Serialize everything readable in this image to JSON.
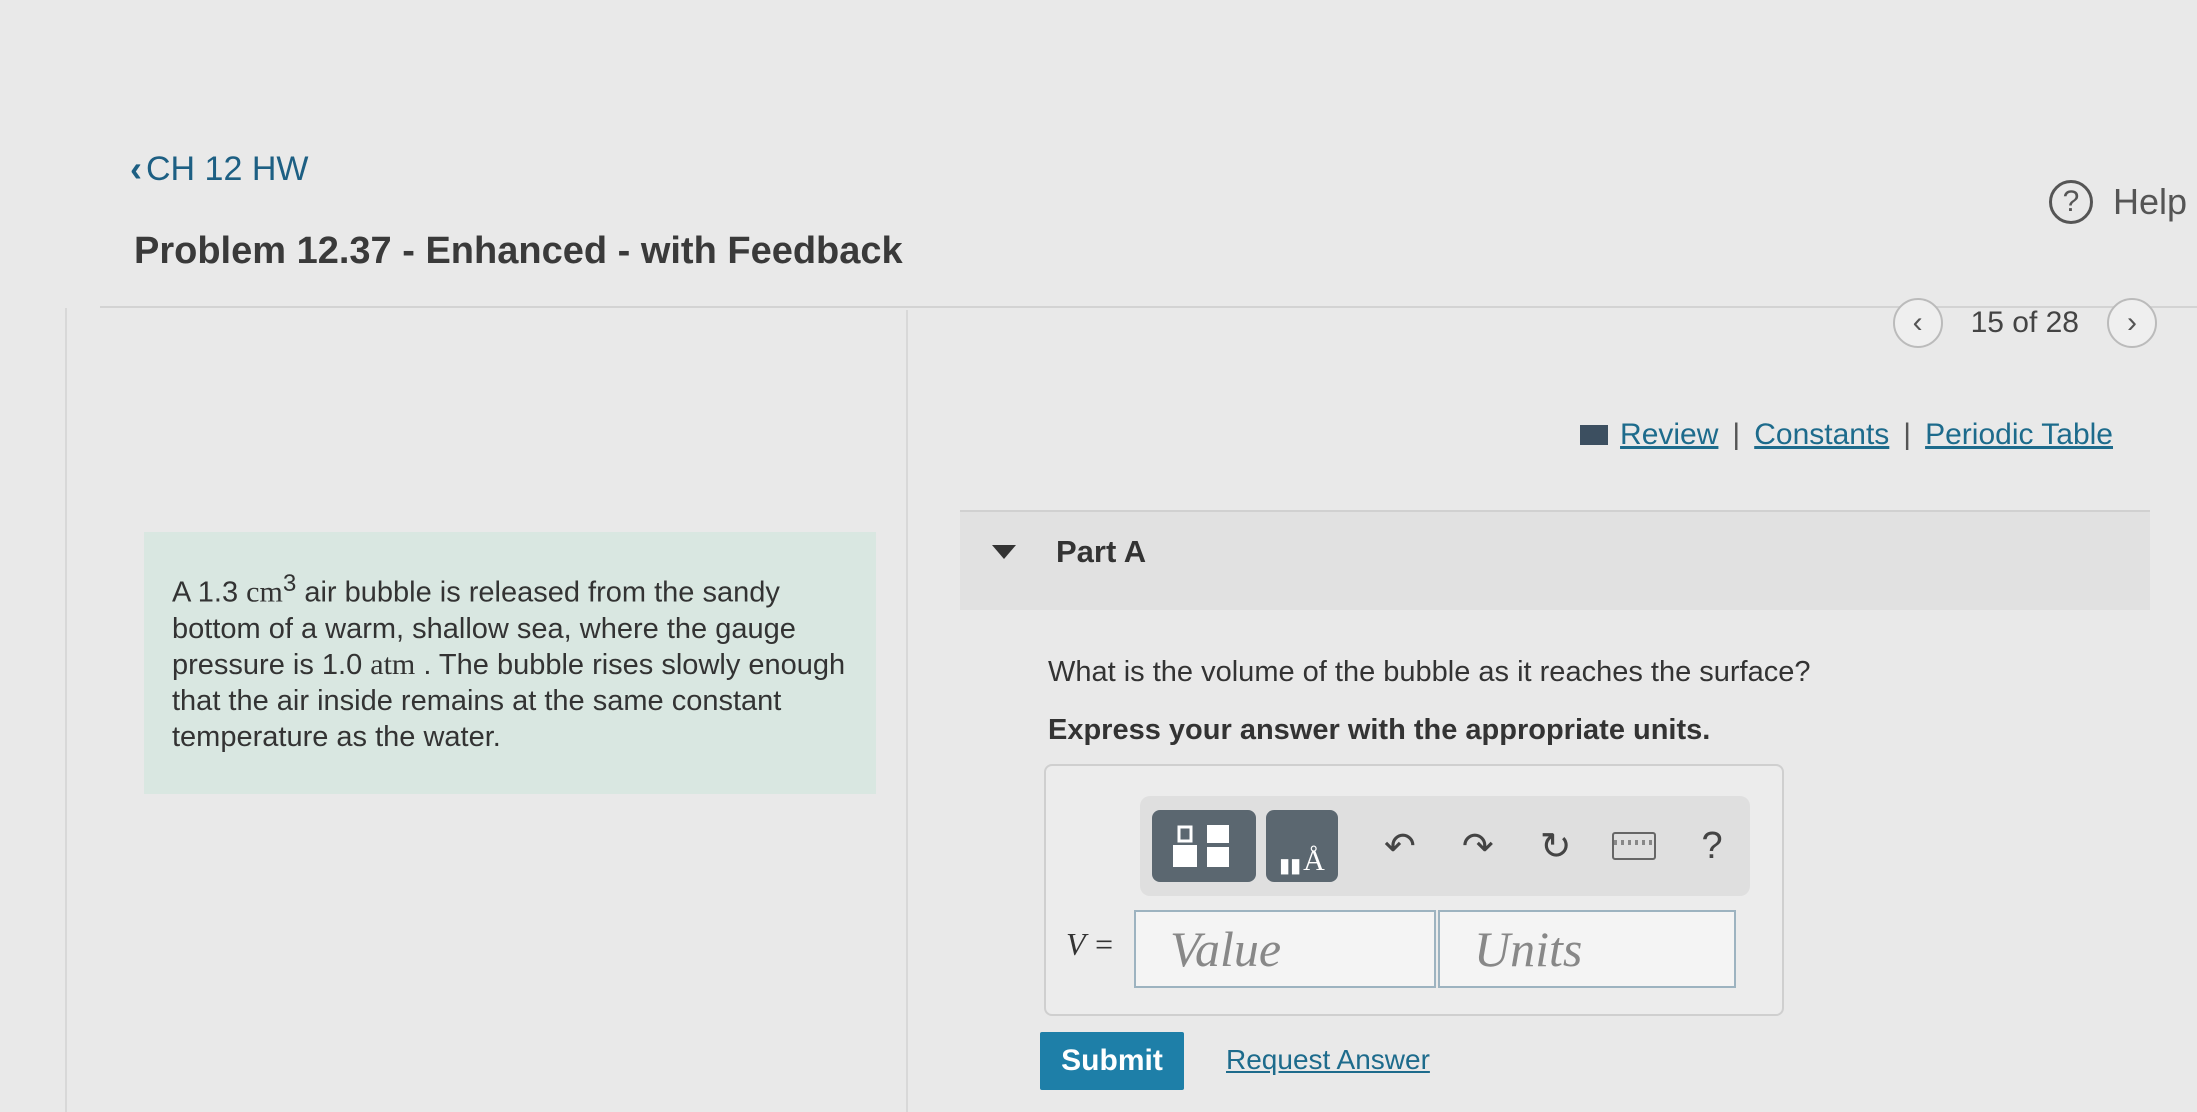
{
  "nav": {
    "back_label": "CH 12 HW"
  },
  "header": {
    "title": "Problem 12.37 - Enhanced - with Feedback",
    "help_label": "Help"
  },
  "pager": {
    "position": "15 of 28"
  },
  "resources": {
    "review": "Review",
    "constants": "Constants",
    "periodic_table": "Periodic Table",
    "separator": "|"
  },
  "problem": {
    "t1": "A 1.3 ",
    "unit_cm": "cm",
    "sup": "3",
    "t2": " air bubble is released from the sandy bottom of a warm, shallow sea, where the gauge pressure is 1.0 ",
    "unit_atm": "atm",
    "t3": " . The bubble rises slowly enough that the air inside remains at the same constant temperature as the water."
  },
  "part": {
    "label": "Part A",
    "question": "What is the volume of the bubble as it reaches the surface?",
    "instruction": "Express your answer with the appropriate units."
  },
  "answer": {
    "variable": "V =",
    "value_placeholder": "Value",
    "units_placeholder": "Units",
    "unit_symbol": "Å",
    "help_symbol": "?"
  },
  "actions": {
    "submit": "Submit",
    "request_answer": "Request Answer"
  }
}
